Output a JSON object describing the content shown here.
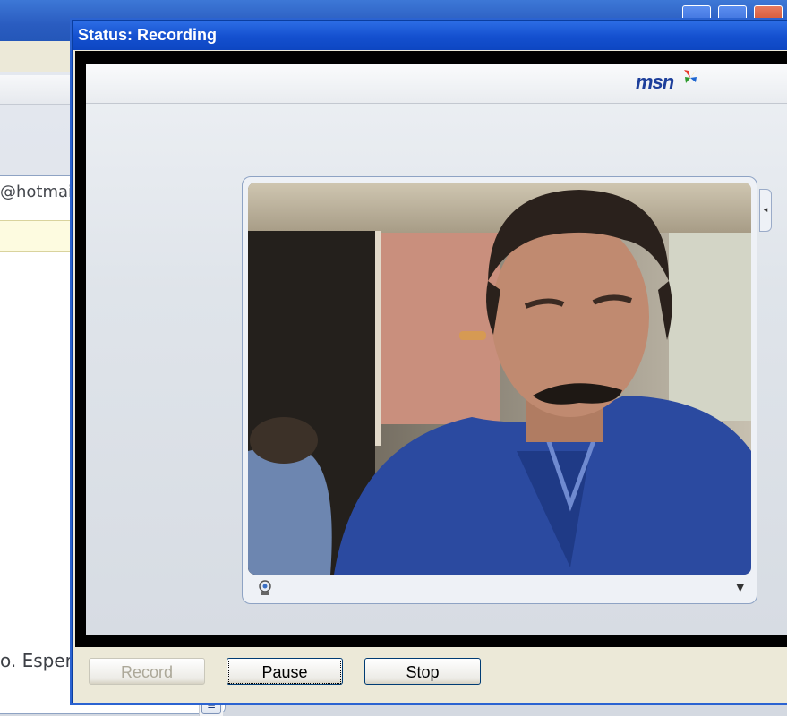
{
  "background_window": {
    "to_field": "@hotmail.com>",
    "status_text": "o. Esper"
  },
  "dialog": {
    "title": "Status: Recording",
    "logo_text": "msn",
    "buttons": {
      "record": "Record",
      "pause": "Pause",
      "stop": "Stop"
    }
  },
  "colors": {
    "title_bar": "#1450cf",
    "msn_blue": "#1d3f9b",
    "sweater": "#2b4aa0"
  }
}
